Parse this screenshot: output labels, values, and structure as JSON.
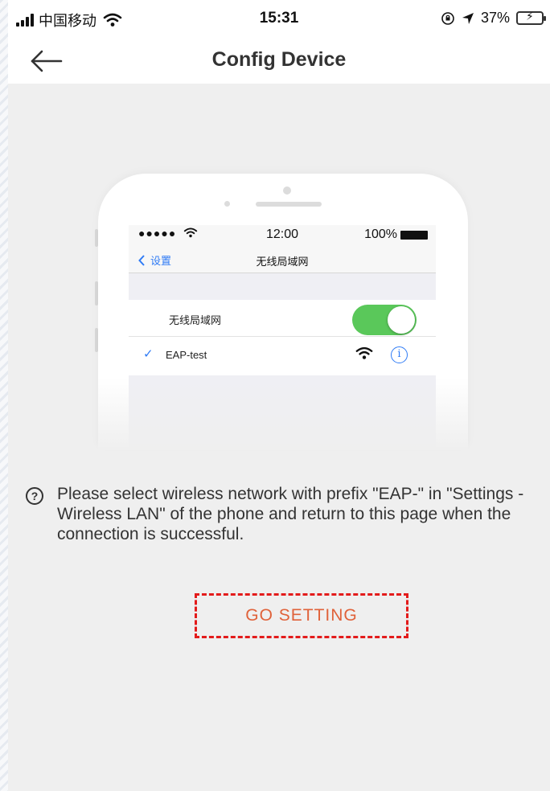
{
  "status_bar": {
    "carrier": "中国移动",
    "time": "15:31",
    "battery": "37%",
    "battery_level": 0.37
  },
  "nav": {
    "title": "Config Device",
    "back_icon": "arrow-left-icon"
  },
  "illustration": {
    "status_dots": "●●●●●",
    "time": "12:00",
    "battery": "100%",
    "back_label": "设置",
    "title": "无线局域网",
    "wlan_label": "无线局域网",
    "wlan_toggle_on": true,
    "network_name": "EAP-test",
    "info_glyph": "i"
  },
  "hint": {
    "icon": "question-circle-icon",
    "text": "Please select wireless network with prefix \"EAP-\" in \"Settings - Wireless LAN\" of the phone and return to this page when the connection is successful."
  },
  "actions": {
    "go_setting_label": "GO SETTING"
  },
  "colors": {
    "background": "#efefef",
    "accent_orange": "#e0623a",
    "highlight_dashed": "#e31b1b",
    "ios_blue": "#2f7bf5",
    "toggle_green": "#5ac85a"
  }
}
